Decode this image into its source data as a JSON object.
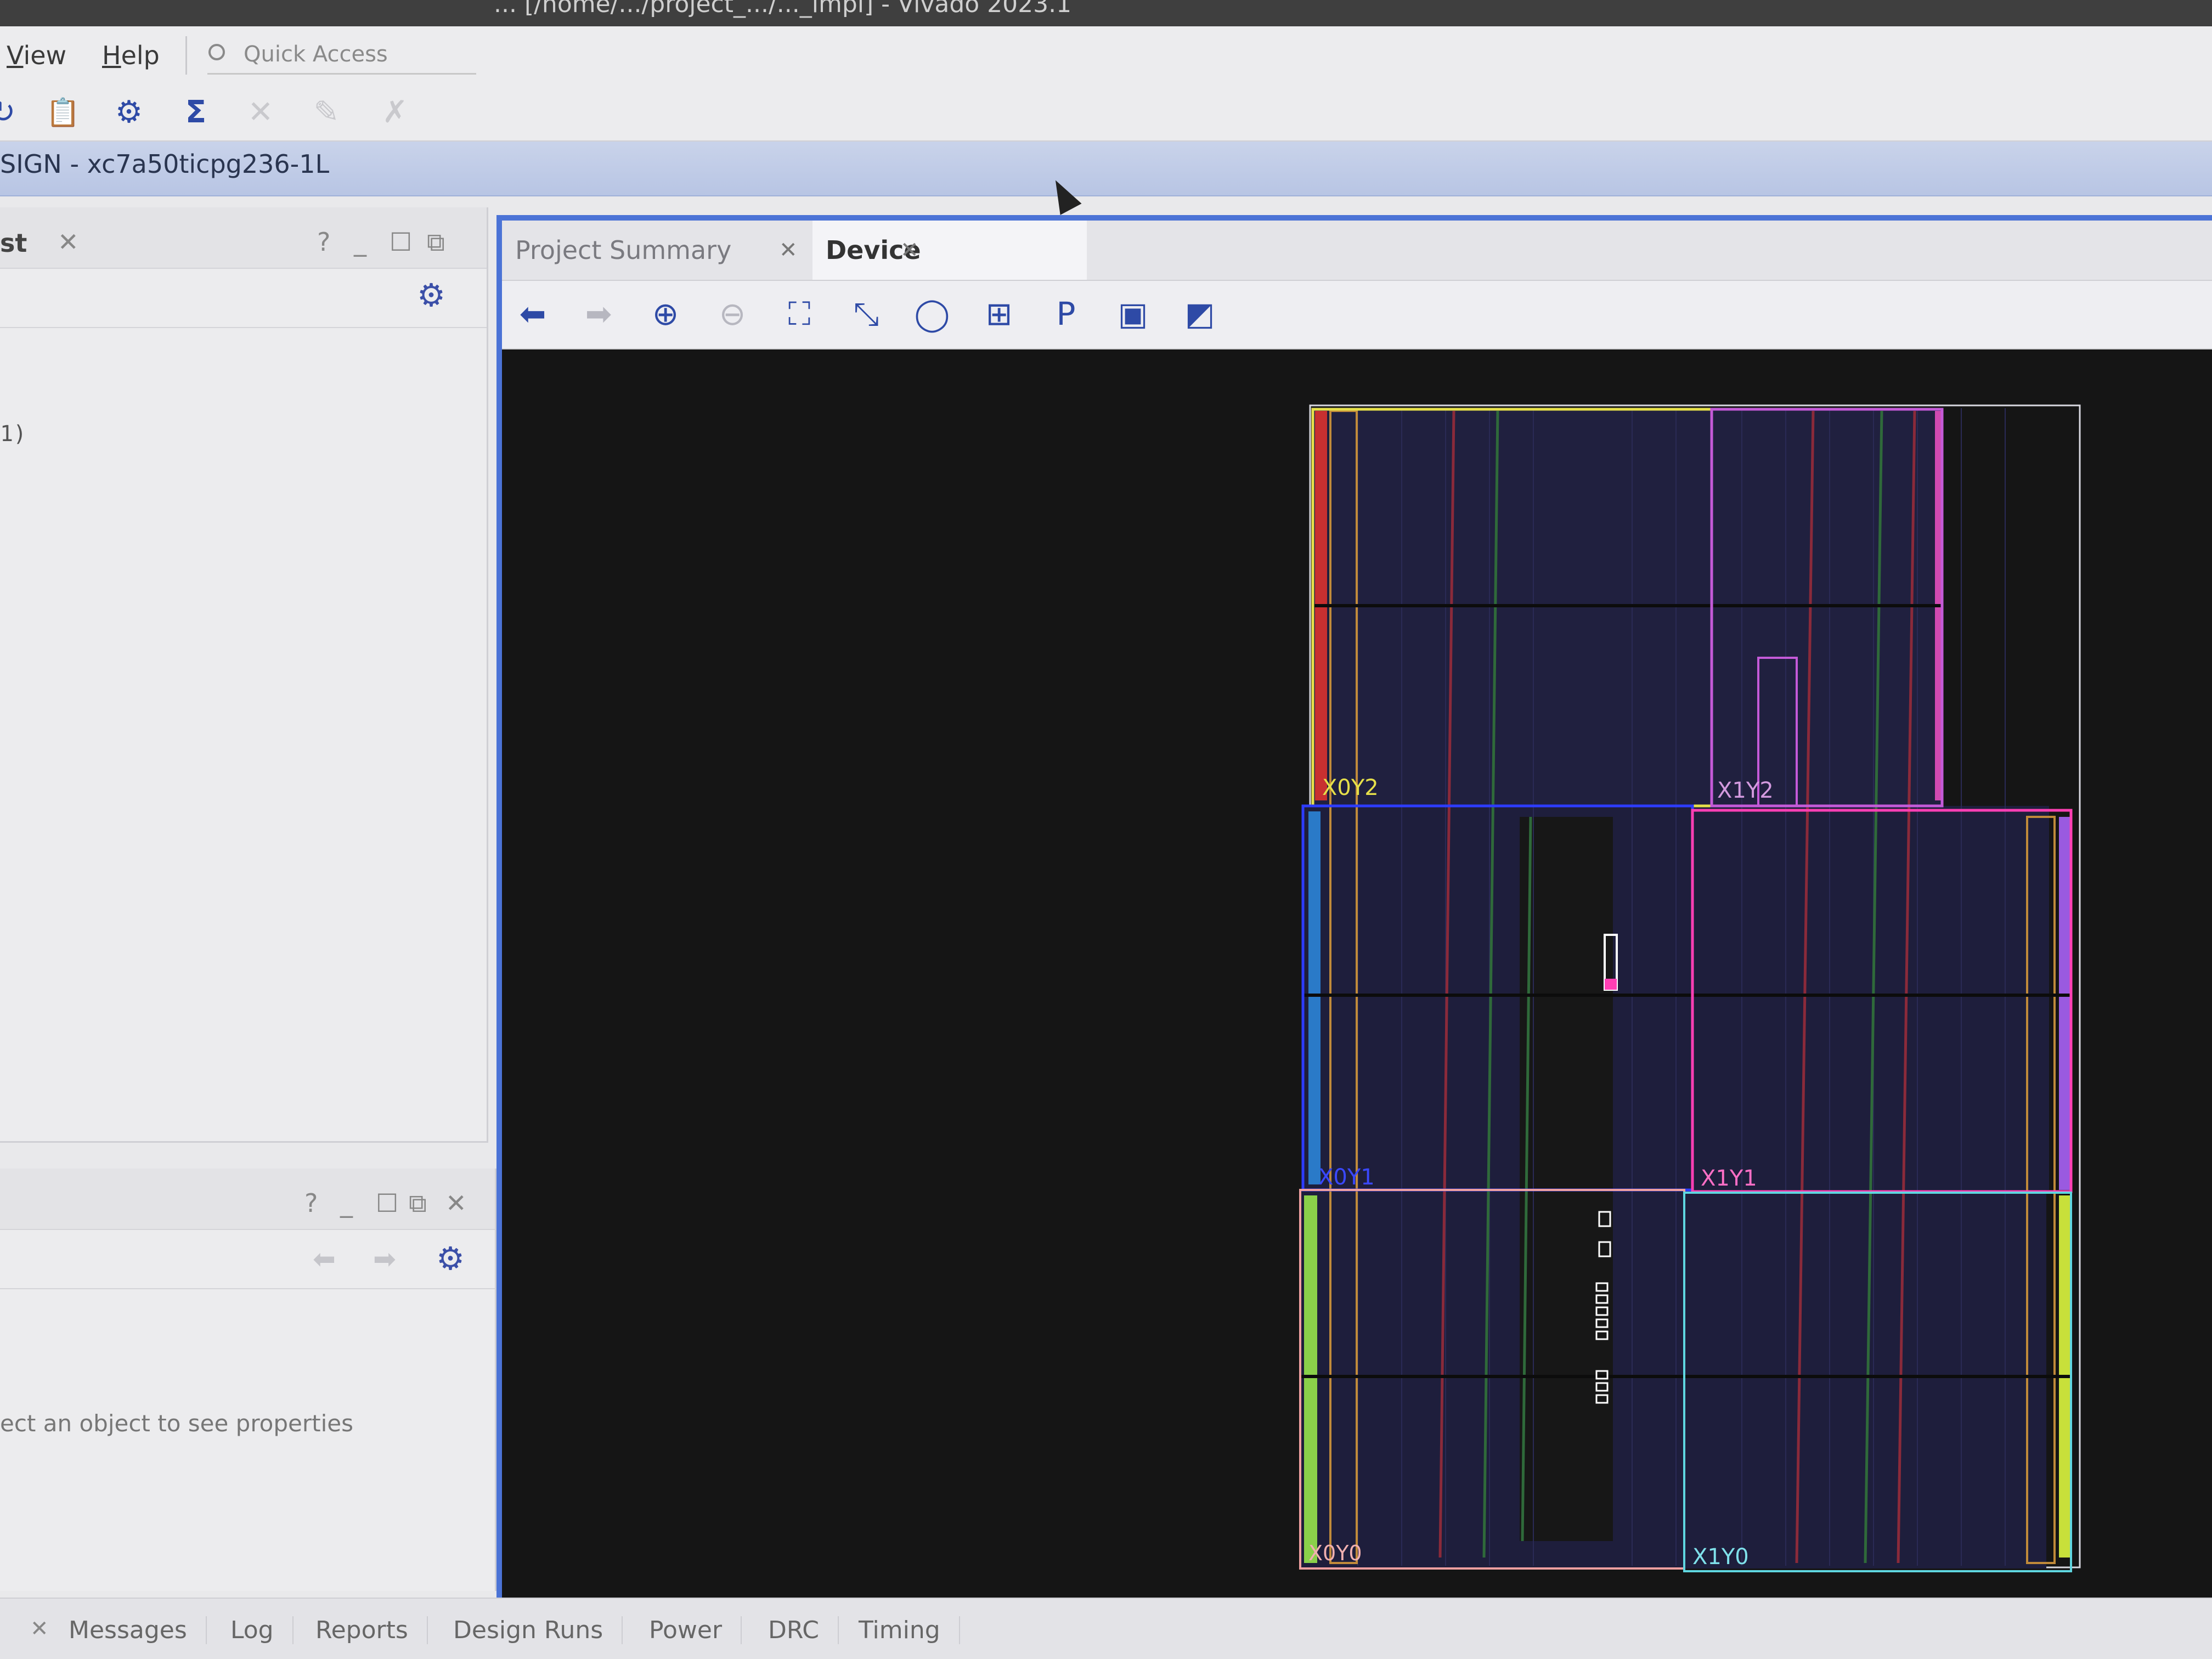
{
  "window": {
    "title": "...  [/home/.../project_.../..._impl]  -  Vivado 2023.1"
  },
  "menu": {
    "view": "View",
    "help": "Help",
    "quick_access": "Quick Access"
  },
  "design_strip": {
    "label": "SIGN - xc7a50ticpg236-1L"
  },
  "left_upper": {
    "tab_label": "st",
    "content_line": "1)"
  },
  "left_lower": {
    "hint": "ect an object to see properties"
  },
  "device_tabs": [
    {
      "label": "Project Summary",
      "active": false
    },
    {
      "label": "Device",
      "active": true
    }
  ],
  "device": {
    "regions": [
      "X0Y2",
      "X1Y2",
      "X0Y1",
      "X1Y1",
      "X0Y0",
      "X1Y0"
    ]
  },
  "bottom_tabs": [
    "Messages",
    "Log",
    "Reports",
    "Design Runs",
    "Power",
    "DRC",
    "Timing"
  ],
  "icons": {
    "accent": "#3b4fa8",
    "frame": "#4b73d6",
    "region_colors": {
      "X0Y2": "#e6e04a",
      "X1Y2": "#c45ad8",
      "X0Y1": "#2d3cff",
      "X1Y1": "#ff3fb4",
      "X0Y0": "#f0a0a0",
      "X1Y0": "#5fd6e0"
    }
  }
}
